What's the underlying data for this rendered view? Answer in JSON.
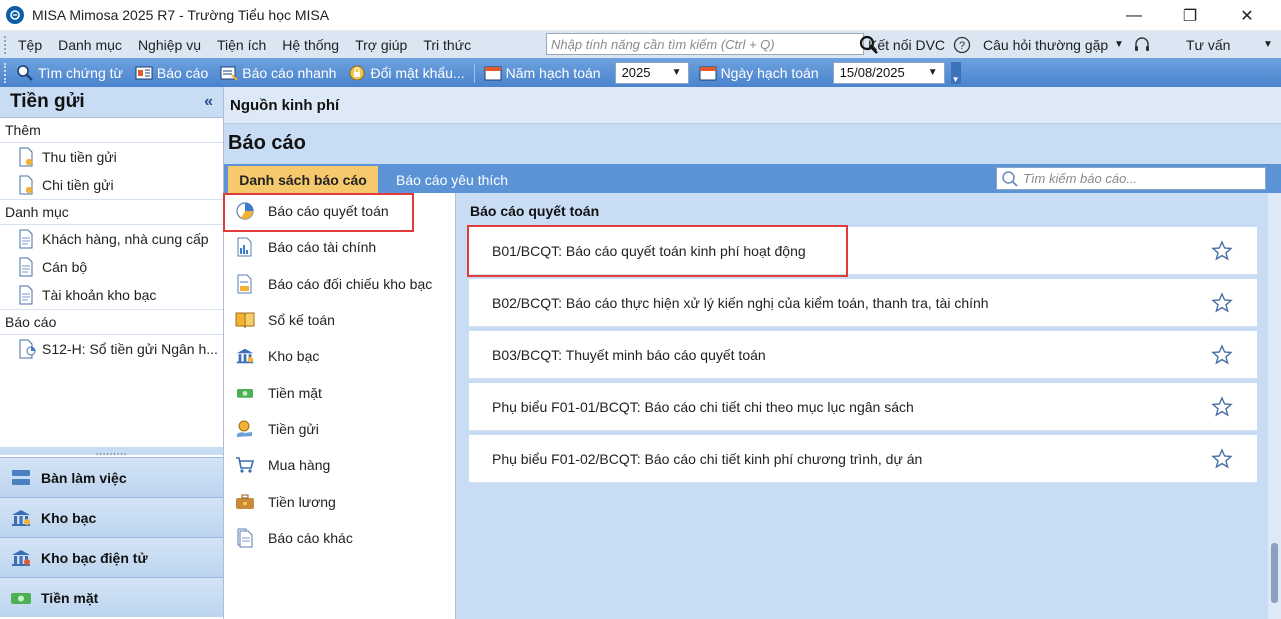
{
  "window": {
    "title": "MISA Mimosa 2025 R7 - Trường Tiểu học MISA",
    "minimize": "—",
    "maximize": "❐",
    "close": "✕"
  },
  "menu": {
    "items": [
      "Tệp",
      "Danh mục",
      "Nghiệp vụ",
      "Tiện ích",
      "Hệ thống",
      "Trợ giúp",
      "Tri thức"
    ],
    "search_placeholder": "Nhập tính năng cần tìm kiếm (Ctrl + Q)",
    "ket_noi_dvc": "Kết nối DVC",
    "faq": "Câu hỏi thường gặp",
    "consult": "Tư vấn"
  },
  "toolbar": {
    "search_docs": "Tìm chứng từ",
    "report": "Báo cáo",
    "quick_report": "Báo cáo nhanh",
    "change_password": "Đổi mật khẩu...",
    "fiscal_year_label": "Năm hạch toán",
    "fiscal_year_value": "2025",
    "posting_date_label": "Ngày hạch toán",
    "posting_date_value": "15/08/2025"
  },
  "left_panel": {
    "title": "Tiền gửi",
    "collapse": "«",
    "groups": [
      {
        "label": "Thêm",
        "items": [
          "Thu tiền gửi",
          "Chi tiền gửi"
        ]
      },
      {
        "label": "Danh mục",
        "items": [
          "Khách hàng, nhà cung cấp",
          "Cán bộ",
          "Tài khoản kho bạc"
        ]
      },
      {
        "label": "Báo cáo",
        "items": [
          "S12-H: Sổ tiền gửi Ngân h..."
        ]
      }
    ],
    "splitter": ",,,,,,,,,",
    "nav": [
      "Bàn làm việc",
      "Kho bạc",
      "Kho bạc điện tử",
      "Tiền mặt"
    ]
  },
  "main": {
    "header": "Nguồn kinh phí",
    "page_title": "Báo cáo",
    "tab_active": "Danh sách báo cáo",
    "tab_other": "Báo cáo yêu thích",
    "search_placeholder": "Tìm kiếm báo cáo...",
    "categories": [
      "Báo cáo quyết toán",
      "Báo cáo tài chính",
      "Báo cáo đối chiếu kho bạc",
      "Sổ kế toán",
      "Kho bạc",
      "Tiền mặt",
      "Tiền gửi",
      "Mua hàng",
      "Tiền lương",
      "Báo cáo khác"
    ],
    "report_group_title": "Báo cáo quyết toán",
    "reports": [
      "B01/BCQT: Báo cáo quyết toán kinh phí hoạt động",
      "B02/BCQT: Báo cáo thực hiện xử lý kiến nghị của kiểm toán, thanh tra, tài chính",
      "B03/BCQT: Thuyết minh báo cáo quyết toán",
      "Phụ biểu F01-01/BCQT: Báo cáo chi tiết chi theo mục lục ngân sách",
      "Phụ biểu F01-02/BCQT: Báo cáo chi tiết kinh phí chương trình, dự án"
    ]
  },
  "colors": {
    "menubar": "#dbe6f3",
    "toolbar": "#5b93d6",
    "active_tab": "#f6c96d",
    "highlight": "#e23b3b",
    "panel_bg": "#c8dcf3"
  }
}
